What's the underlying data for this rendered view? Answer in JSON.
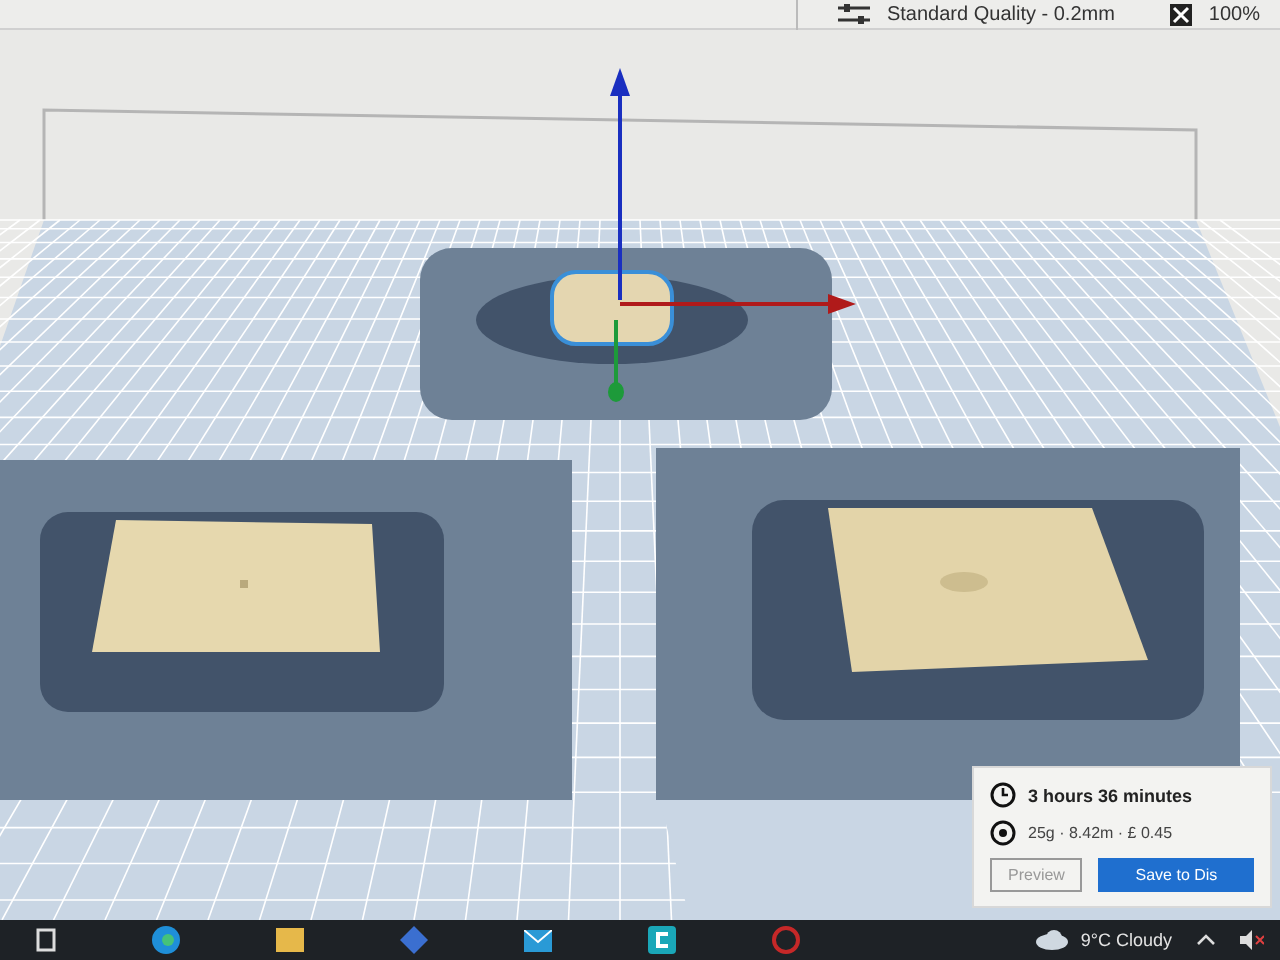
{
  "toolbar": {
    "profile": "Standard Quality - 0.2mm",
    "infill": "100%"
  },
  "print_panel": {
    "time": "3 hours 36 minutes",
    "material": "25g · 8.42m · £ 0.45",
    "buttons": [
      {
        "label": "Preview",
        "kind": "secondary"
      },
      {
        "label": "Save to Dis",
        "kind": "primary"
      }
    ]
  },
  "taskbar": {
    "weather": "9°C Cloudy"
  }
}
